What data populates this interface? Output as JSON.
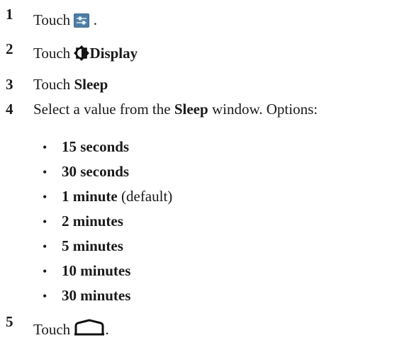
{
  "steps": [
    {
      "number": "1",
      "text": "Touch",
      "suffix": " ."
    },
    {
      "number": "2",
      "text": "Touch",
      "bold": "Display"
    },
    {
      "number": "3",
      "text": "Touch",
      "bold": "Sleep"
    },
    {
      "number": "4",
      "pre": "Select a value from the",
      "bold": "Sleep",
      "post": "window. Options:"
    },
    {
      "number": "5",
      "text": "Touch",
      "suffix": "."
    }
  ],
  "options": [
    {
      "label": "15 seconds",
      "note": ""
    },
    {
      "label": "30 seconds",
      "note": ""
    },
    {
      "label": "1 minute",
      "note": "(default)"
    },
    {
      "label": "2 minutes",
      "note": ""
    },
    {
      "label": "5 minutes",
      "note": ""
    },
    {
      "label": "10 minutes",
      "note": ""
    },
    {
      "label": "30 minutes",
      "note": ""
    }
  ],
  "bullet_char": "•",
  "icons": {
    "settings": "settings-icon",
    "display": "display-brightness-icon",
    "home": "home-icon"
  }
}
